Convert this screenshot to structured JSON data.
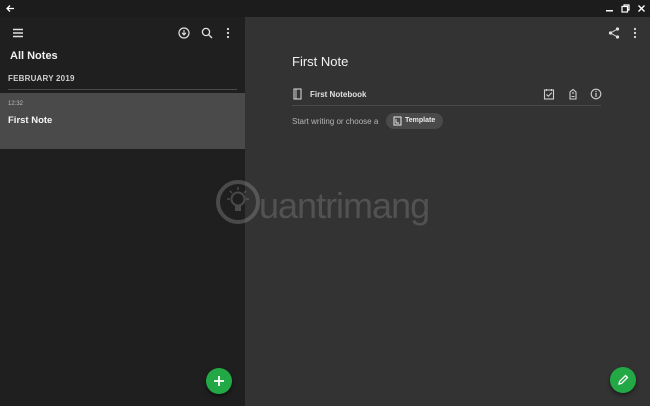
{
  "sidebar": {
    "title": "All Notes",
    "month_header": "FEBRUARY 2019",
    "notes": [
      {
        "time": "12:32",
        "title": "First Note"
      }
    ]
  },
  "editor": {
    "note_title": "First Note",
    "notebook": "First Notebook",
    "start_prompt": "Start writing or choose a",
    "template_label": "Template"
  },
  "watermark": {
    "text": "uantrimang"
  },
  "colors": {
    "accent_green": "#22a845",
    "sidebar_bg": "#1f1f1f",
    "editor_bg": "#333333",
    "selected_note_bg": "#4a4a4a"
  },
  "icons": {
    "titlebar": [
      "back-arrow-icon",
      "minimize-icon",
      "restore-icon",
      "close-icon"
    ],
    "sidebar_toolbar": [
      "hamburger-menu-icon",
      "sync-icon",
      "search-icon",
      "more-vert-icon"
    ],
    "editor_toolbar": [
      "share-icon",
      "more-vert-icon"
    ],
    "note_meta": [
      "notebook-icon",
      "reminder-icon",
      "tag-icon",
      "info-icon"
    ]
  }
}
